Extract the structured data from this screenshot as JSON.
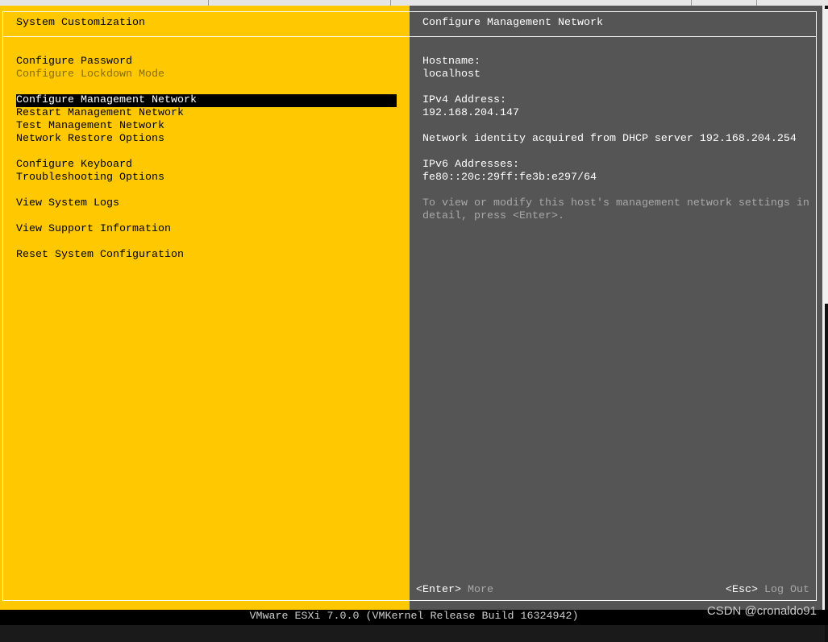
{
  "left": {
    "title": "System Customization",
    "items": [
      {
        "label": "Configure Password",
        "state": "normal"
      },
      {
        "label": "Configure Lockdown Mode",
        "state": "disabled"
      },
      {
        "label": "Configure Management Network",
        "state": "selected"
      },
      {
        "label": "Restart Management Network",
        "state": "normal"
      },
      {
        "label": "Test Management Network",
        "state": "normal"
      },
      {
        "label": "Network Restore Options",
        "state": "normal"
      },
      {
        "label": "Configure Keyboard",
        "state": "normal"
      },
      {
        "label": "Troubleshooting Options",
        "state": "normal"
      },
      {
        "label": "View System Logs",
        "state": "normal"
      },
      {
        "label": "View Support Information",
        "state": "normal"
      },
      {
        "label": "Reset System Configuration",
        "state": "normal"
      }
    ]
  },
  "right": {
    "title": "Configure Management Network",
    "hostname_label": "Hostname:",
    "hostname": "localhost",
    "ipv4_label": "IPv4 Address:",
    "ipv4": "192.168.204.147",
    "dhcp_note": "Network identity acquired from DHCP server 192.168.204.254",
    "ipv6_label": "IPv6 Addresses:",
    "ipv6": "fe80::20c:29ff:fe3b:e297/64",
    "hint1": "To view or modify this host's management network settings in",
    "hint2": "detail, press <Enter>."
  },
  "footer": {
    "enter_key": "<Enter>",
    "enter_action": "More",
    "esc_key": "<Esc>",
    "esc_action": "Log Out"
  },
  "status_bar": "VMware ESXi 7.0.0 (VMKernel Release Build 16324942)",
  "watermark": "CSDN @cronaldo91",
  "colors": {
    "left_bg": "#ffc800",
    "right_bg": "#555555"
  }
}
